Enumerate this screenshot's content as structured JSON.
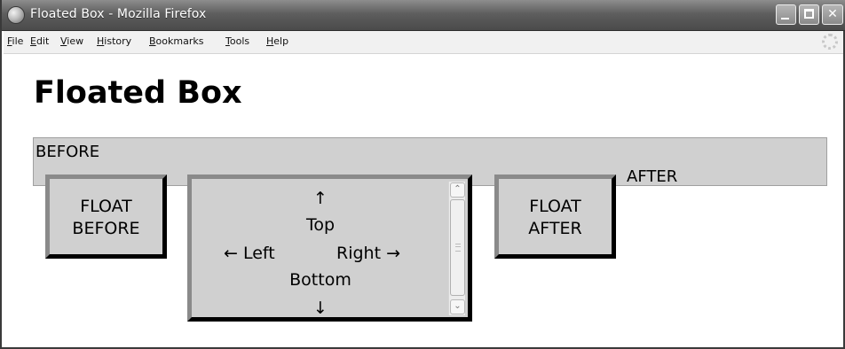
{
  "window": {
    "title": "Floated Box - Mozilla Firefox"
  },
  "menu": {
    "items": [
      "File",
      "Edit",
      "View",
      "History",
      "Bookmarks",
      "Tools",
      "Help"
    ]
  },
  "page": {
    "heading": "Floated Box",
    "before_text": "BEFORE",
    "after_text": "AFTER",
    "float_before": {
      "line1": "FLOAT",
      "line2": "BEFORE"
    },
    "float_after": {
      "line1": "FLOAT",
      "line2": "AFTER"
    },
    "center_box": {
      "up": "↑",
      "top": "Top",
      "left": "← Left",
      "right": "Right →",
      "bottom": "Bottom",
      "down": "↓"
    }
  },
  "colors": {
    "banner_background": "#d0d0d0",
    "box_background": "#d0d0d0",
    "title_bar": "#5e5e5e"
  }
}
